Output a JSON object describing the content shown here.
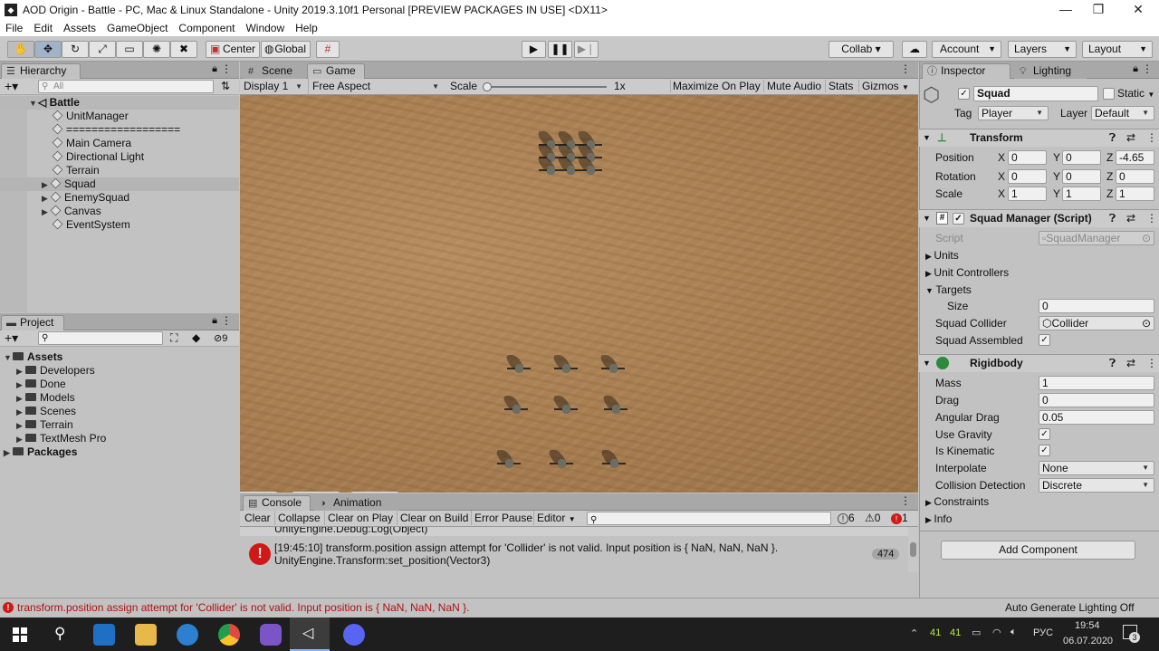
{
  "window": {
    "title": "AOD Origin - Battle - PC, Mac & Linux Standalone - Unity 2019.3.10f1 Personal [PREVIEW PACKAGES IN USE] <DX11>",
    "minimize": "—",
    "maximize": "❐",
    "close": "✕"
  },
  "menu": [
    "File",
    "Edit",
    "Assets",
    "GameObject",
    "Component",
    "Window",
    "Help"
  ],
  "toolbar": {
    "center_label": "Center",
    "global_label": "Global",
    "collab_label": "Collab",
    "account_label": "Account",
    "layers_label": "Layers",
    "layout_label": "Layout"
  },
  "hierarchy": {
    "tab": "Hierarchy",
    "search_placeholder": "All",
    "scene_name": "Battle",
    "items": [
      {
        "label": "UnitManager",
        "expandable": false
      },
      {
        "label": "==================",
        "expandable": false
      },
      {
        "label": "Main Camera",
        "expandable": false
      },
      {
        "label": "Directional Light",
        "expandable": false
      },
      {
        "label": "Terrain",
        "expandable": false
      },
      {
        "label": "Squad",
        "expandable": true,
        "selected": true
      },
      {
        "label": "EnemySquad",
        "expandable": true
      },
      {
        "label": "Canvas",
        "expandable": true
      },
      {
        "label": "EventSystem",
        "expandable": false
      }
    ]
  },
  "project": {
    "tab": "Project",
    "hidden_count": "9",
    "assets_label": "Assets",
    "folders": [
      "Developers",
      "Done",
      "Models",
      "Scenes",
      "Terrain",
      "TextMesh Pro"
    ],
    "packages_label": "Packages"
  },
  "game": {
    "scene_tab": "Scene",
    "game_tab": "Game",
    "display": "Display 1",
    "aspect": "Free Aspect",
    "scale_label": "Scale",
    "scale_value": "1x",
    "maximize_on_play": "Maximize On Play",
    "mute_audio": "Mute Audio",
    "stats": "Stats",
    "gizmos": "Gizmos"
  },
  "console": {
    "tab": "Console",
    "animation_tab": "Animation",
    "buttons": [
      "Clear",
      "Collapse",
      "Clear on Play",
      "Clear on Build",
      "Error Pause",
      "Editor"
    ],
    "info_count": "6",
    "warning_count": "0",
    "error_count": "1",
    "partial_line": "UnityEngine.Debug:Log(Object)",
    "message_line1": "[19:45:10] transform.position assign attempt for 'Collider' is not valid. Input position is { NaN, NaN, NaN }.",
    "message_line2": "UnityEngine.Transform:set_position(Vector3)",
    "message_count": "474"
  },
  "inspector": {
    "tab": "Inspector",
    "lighting_tab": "Lighting",
    "object_name": "Squad",
    "static_label": "Static",
    "tag_label": "Tag",
    "tag_value": "Player",
    "layer_label": "Layer",
    "layer_value": "Default",
    "transform": {
      "title": "Transform",
      "position_label": "Position",
      "rotation_label": "Rotation",
      "scale_label": "Scale",
      "position": {
        "x": "0",
        "y": "0",
        "z": "-4.65"
      },
      "rotation": {
        "x": "0",
        "y": "0",
        "z": "0"
      },
      "scale": {
        "x": "1",
        "y": "1",
        "z": "1"
      }
    },
    "squad_manager": {
      "title": "Squad Manager (Script)",
      "script_label": "Script",
      "script_value": "SquadManager",
      "units_label": "Units",
      "unit_controllers_label": "Unit Controllers",
      "targets_label": "Targets",
      "size_label": "Size",
      "size_value": "0",
      "squad_collider_label": "Squad Collider",
      "squad_collider_value": "Collider",
      "squad_assembled_label": "Squad Assembled"
    },
    "rigidbody": {
      "title": "Rigidbody",
      "mass_label": "Mass",
      "mass": "1",
      "drag_label": "Drag",
      "drag": "0",
      "angular_drag_label": "Angular Drag",
      "angular_drag": "0.05",
      "use_gravity_label": "Use Gravity",
      "is_kinematic_label": "Is Kinematic",
      "interpolate_label": "Interpolate",
      "interpolate": "None",
      "collision_detection_label": "Collision Detection",
      "collision_detection": "Discrete",
      "constraints_label": "Constraints",
      "info_label": "Info"
    },
    "add_component": "Add Component"
  },
  "status": {
    "error_message": "transform.position assign attempt for 'Collider' is not valid. Input position is { NaN, NaN, NaN }.",
    "lighting": "Auto Generate Lighting Off"
  },
  "taskbar": {
    "tray_41a": "41",
    "tray_41b": "41",
    "language": "РУС",
    "time": "19:54",
    "date": "06.07.2020",
    "notifications": "3"
  }
}
